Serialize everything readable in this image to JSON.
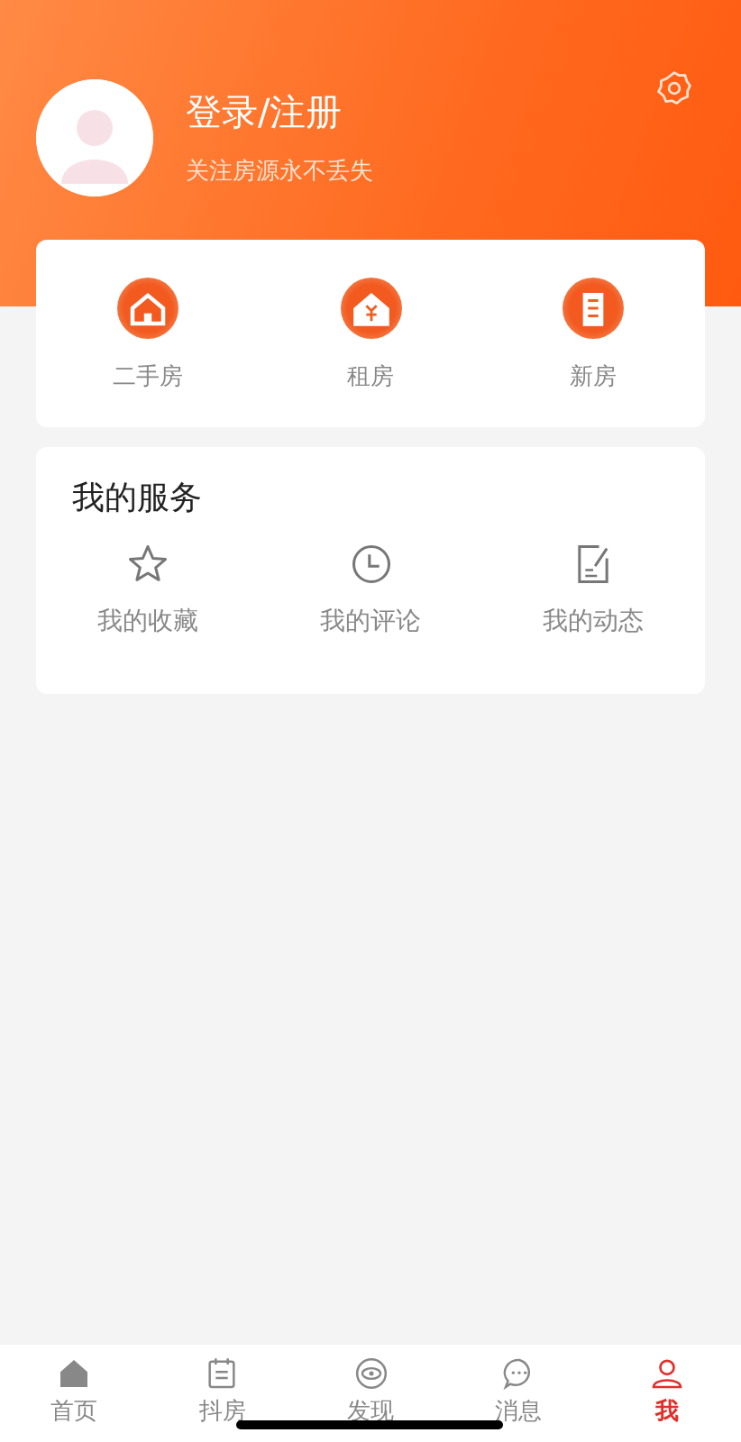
{
  "profile": {
    "title": "登录/注册",
    "subtitle": "关注房源永不丢失"
  },
  "categories": [
    {
      "label": "二手房"
    },
    {
      "label": "租房"
    },
    {
      "label": "新房"
    }
  ],
  "services": {
    "title": "我的服务",
    "items": [
      {
        "label": "我的收藏"
      },
      {
        "label": "我的评论"
      },
      {
        "label": "我的动态"
      }
    ]
  },
  "tab_bar": [
    {
      "label": "首页",
      "selected": false
    },
    {
      "label": "抖房",
      "selected": false
    },
    {
      "label": "发现",
      "selected": false
    },
    {
      "label": "消息",
      "selected": false
    },
    {
      "label": "我",
      "selected": true
    }
  ]
}
